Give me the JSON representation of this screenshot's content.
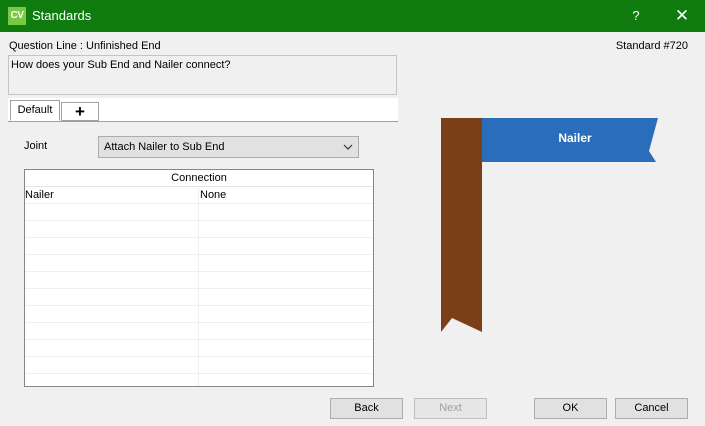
{
  "window": {
    "app_icon_text": "CV",
    "title": "Standards",
    "help_label": "?",
    "close_label": "✕"
  },
  "header": {
    "question_line": "Question Line : Unfinished End",
    "standard_number": "Standard #720"
  },
  "question": {
    "text": "How does your Sub End and Nailer connect?"
  },
  "tabs": {
    "items": [
      {
        "label": "Default",
        "selected": true
      },
      {
        "label": "+",
        "selected": false
      }
    ]
  },
  "joint": {
    "label": "Joint",
    "selected_value": "Attach Nailer to Sub End"
  },
  "grid": {
    "header": "Connection",
    "rows": [
      [
        "Nailer",
        "None"
      ],
      [
        "",
        ""
      ],
      [
        "",
        ""
      ],
      [
        "",
        ""
      ],
      [
        "",
        ""
      ],
      [
        "",
        ""
      ],
      [
        "",
        ""
      ],
      [
        "",
        ""
      ],
      [
        "",
        ""
      ],
      [
        "",
        ""
      ],
      [
        "",
        ""
      ],
      [
        "",
        ""
      ]
    ]
  },
  "illustration": {
    "banner_label": "Nailer",
    "colors": {
      "post": "#7b3f18",
      "banner": "#2a6ebb"
    }
  },
  "buttons": {
    "back": "Back",
    "next": "Next",
    "ok": "OK",
    "cancel": "Cancel"
  },
  "colors": {
    "titlebar": "#107c10",
    "app_icon": "#7ac943"
  }
}
